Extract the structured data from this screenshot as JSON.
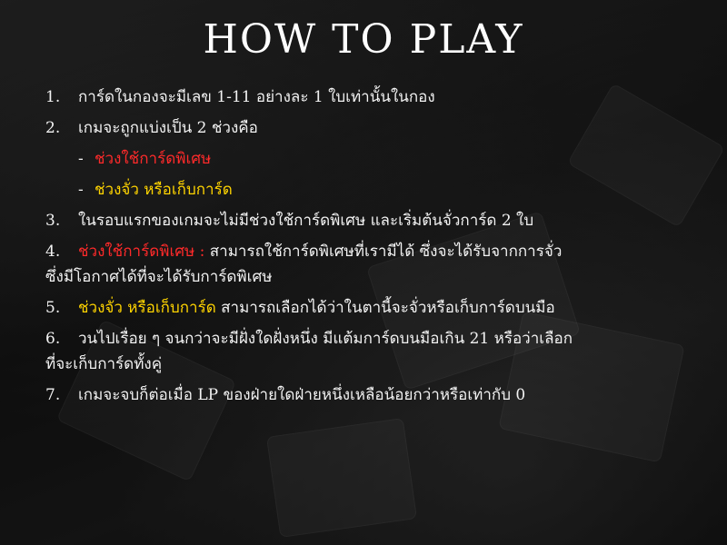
{
  "title": "HOW TO PLAY",
  "rules": {
    "r1": {
      "num": "1.",
      "text": "การ์ดในกองจะมีเลข 1-11 อย่างละ 1 ใบเท่านั้นในกอง"
    },
    "r2": {
      "num": "2.",
      "text": "เกมจะถูกแบ่งเป็น 2 ช่วงคือ"
    },
    "s1": {
      "dash": "-",
      "text": "ช่วงใช้การ์ดพิเศษ"
    },
    "s2": {
      "dash": "-",
      "text": "ช่วงจั่ว หรือเก็บการ์ด"
    },
    "r3": {
      "num": "3.",
      "text": "ในรอบแรกของเกมจะไม่มีช่วงใช้การ์ดพิเศษ และเริ่มต้นจั่วการ์ด 2 ใบ"
    },
    "r4": {
      "num": "4.",
      "highlight": "ช่วงใช้การ์ดพิเศษ :",
      "text": " สามารถใช้การ์ดพิเศษที่เรามีได้ ซึ่งจะได้รับจากการจั่ว",
      "cont": "ซึ่งมีโอกาศได้ที่จะได้รับการ์ดพิเศษ"
    },
    "r5": {
      "num": "5.",
      "highlight": "ช่วงจั่ว หรือเก็บการ์ด",
      "text": " สามารถเลือกได้ว่าในตานี้จะจั่วหรือเก็บการ์ดบนมือ"
    },
    "r6": {
      "num": "6.",
      "text": "วนไปเรื่อย ๆ จนกว่าจะมีฝั่งใดฝั่งหนึ่ง มีแต้มการ์ดบนมือเกิน 21 หรือว่าเลือก",
      "cont": "ที่จะเก็บการ์ดทั้งคู่"
    },
    "r7": {
      "num": "7.",
      "text": "เกมจะจบก็ต่อเมื่อ LP ของฝ่ายใดฝ่ายหนึ่งเหลือน้อยกว่าหรือเท่ากับ 0"
    }
  },
  "colors": {
    "highlight_red": "#ff2a2a",
    "highlight_yellow": "#ffd400",
    "text": "#f2f2f2"
  }
}
